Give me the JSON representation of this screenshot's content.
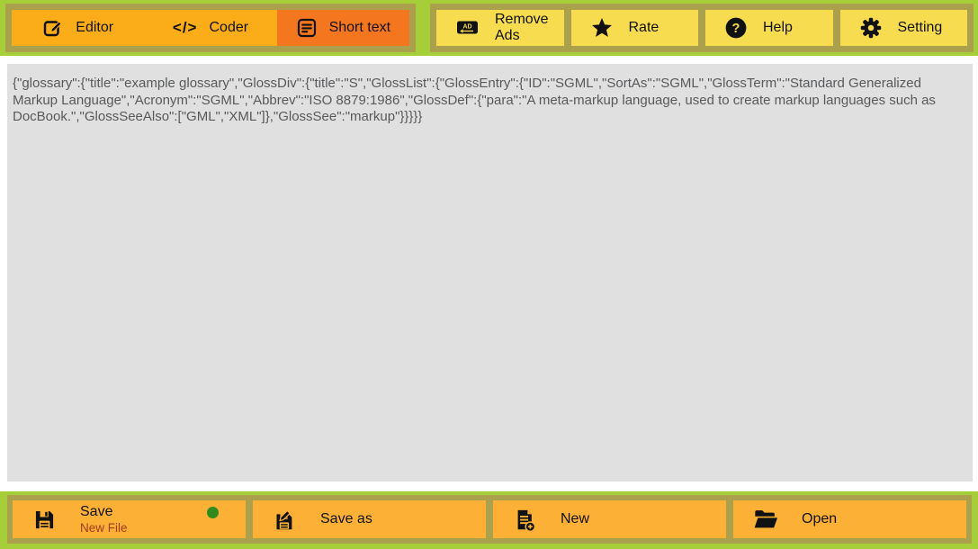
{
  "app": {
    "tabs": [
      {
        "label": "Editor",
        "icon": "edit-icon",
        "selected": false
      },
      {
        "label": "Coder",
        "icon": "code-icon",
        "icon_glyph": "</>",
        "selected": false
      },
      {
        "label": "Short text",
        "icon": "short-text-icon",
        "selected": true
      }
    ],
    "actions": [
      {
        "label": "Remove Ads",
        "icon": "remove-ads-icon",
        "icon_badge": "AD"
      },
      {
        "label": "Rate",
        "icon": "star-icon"
      },
      {
        "label": "Help",
        "icon": "help-icon",
        "icon_glyph": "?"
      },
      {
        "label": "Setting",
        "icon": "gear-icon"
      }
    ],
    "editor": {
      "content": "{\"glossary\":{\"title\":\"example glossary\",\"GlossDiv\":{\"title\":\"S\",\"GlossList\":{\"GlossEntry\":{\"ID\":\"SGML\",\"SortAs\":\"SGML\",\"GlossTerm\":\"Standard Generalized Markup Language\",\"Acronym\":\"SGML\",\"Abbrev\":\"ISO 8879:1986\",\"GlossDef\":{\"para\":\"A meta-markup language, used to create markup languages such as DocBook.\",\"GlossSeeAlso\":[\"GML\",\"XML\"]},\"GlossSee\":\"markup\"}}}}}"
    },
    "file_actions": [
      {
        "label": "Save",
        "sublabel": "New File",
        "icon": "save-icon",
        "has_status_dot": true
      },
      {
        "label": "Save as",
        "icon": "save-as-icon"
      },
      {
        "label": "New",
        "icon": "new-file-icon"
      },
      {
        "label": "Open",
        "icon": "open-folder-icon"
      }
    ],
    "colors": {
      "background_green": "#A6CE39",
      "group_border_olive": "#ABA14C",
      "tab_orange": "#FBAC19",
      "tab_selected_orange": "#F4761F",
      "action_yellow": "#F8DC4F",
      "file_button_orange": "#FCB136",
      "panel_white": "#FFFFFF",
      "editor_gray": "#E0E0E0",
      "editor_text_gray": "#58595B",
      "sublabel_red": "#9E3B20",
      "status_dot_green": "#338A1C",
      "icon_black": "#111111"
    }
  }
}
